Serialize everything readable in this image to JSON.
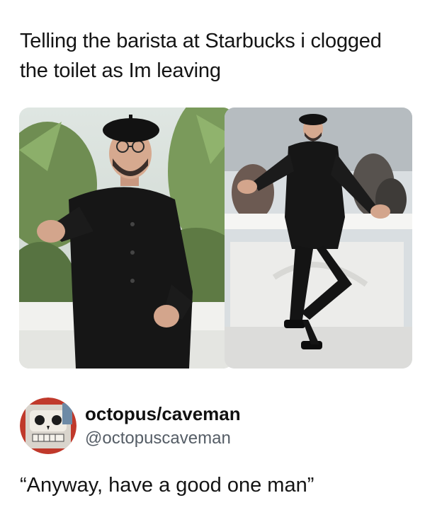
{
  "post": {
    "caption": "Telling the barista at Starbucks i clogged the toilet as Im leaving"
  },
  "images": [
    {
      "icon": "photo-man-in-beret-pointing"
    },
    {
      "icon": "photo-man-in-beret-leaning"
    }
  ],
  "author": {
    "display_name": "octopus/caveman",
    "handle": "@octopuscaveman",
    "avatar_icon": "skull-avatar-icon"
  },
  "reply": {
    "text": "“Anyway, have a good one man”"
  },
  "colors": {
    "outfit": "#161616",
    "foliage": "#5e7a44",
    "sky": "#eef1f3",
    "avatar_red": "#c0392b"
  }
}
